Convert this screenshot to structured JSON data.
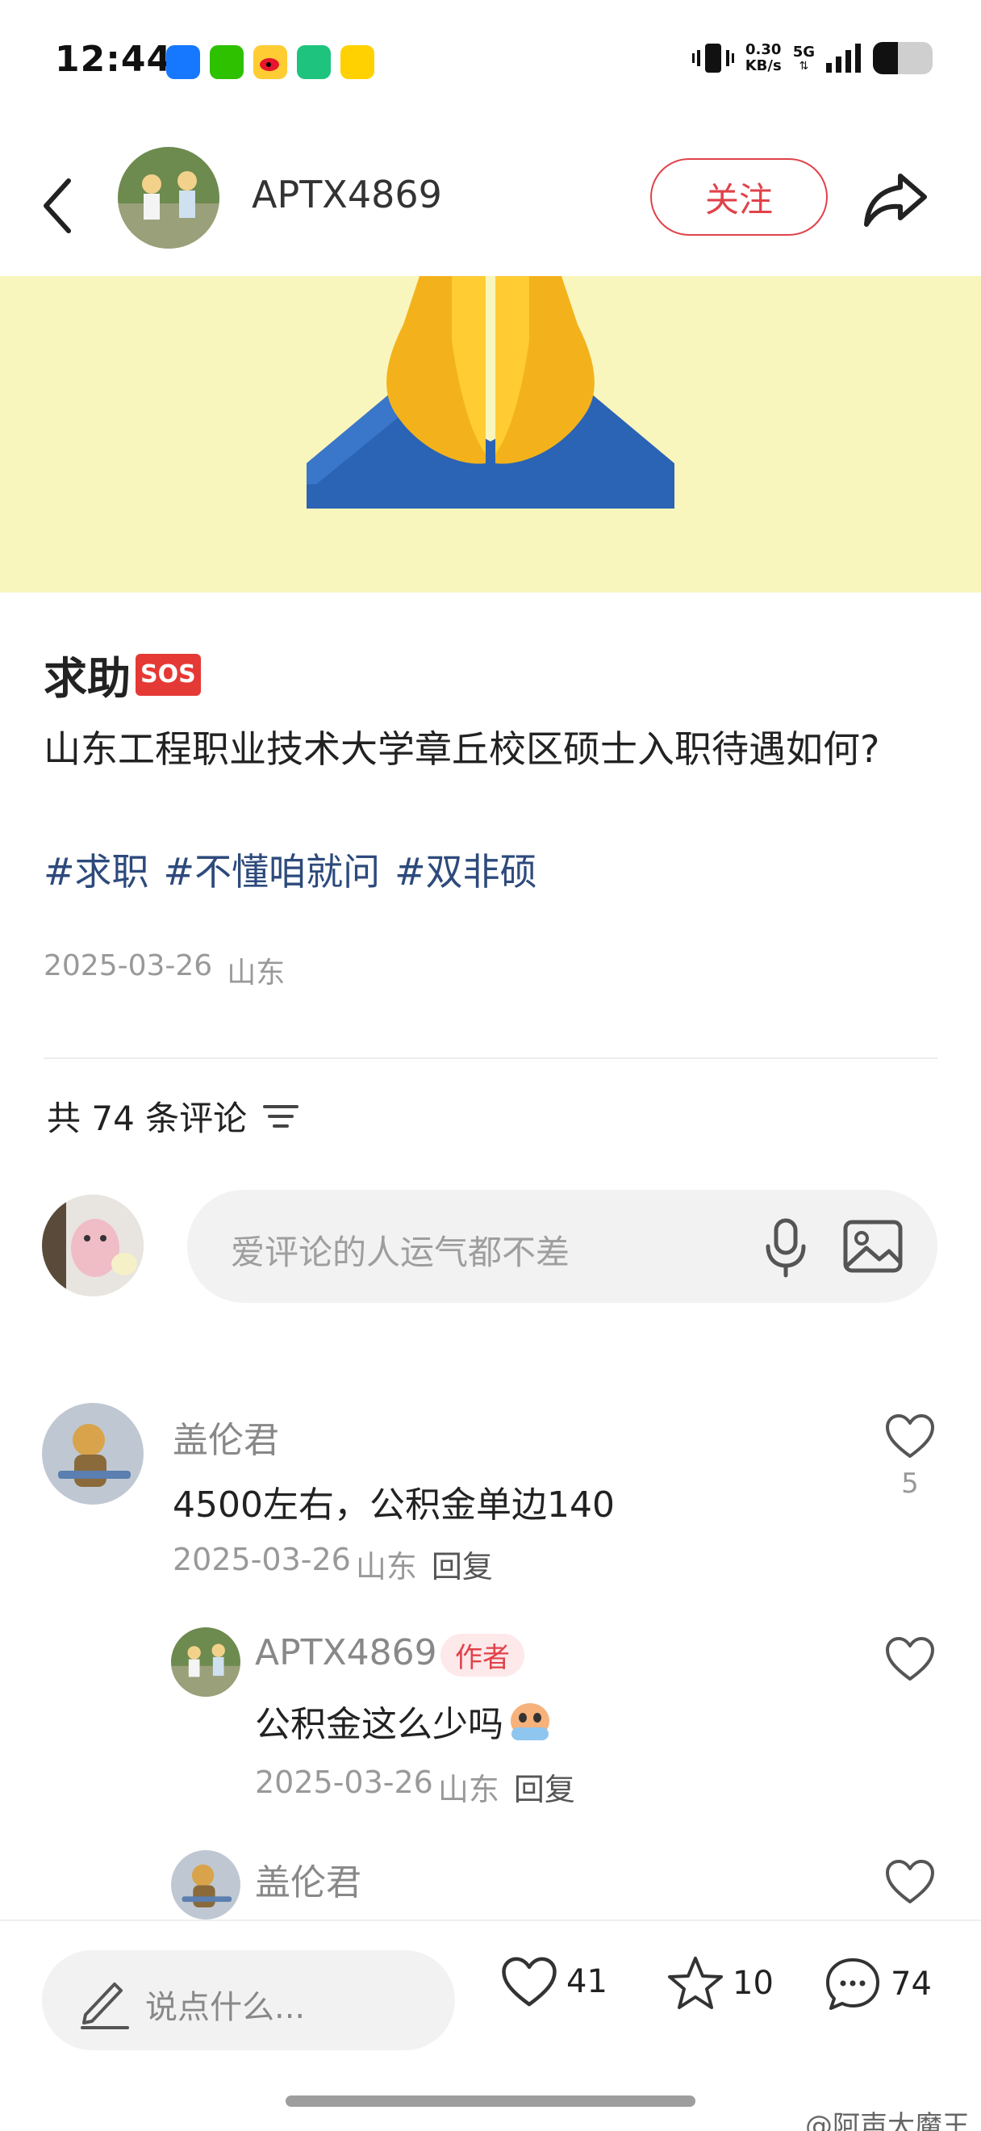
{
  "status_bar": {
    "time": "12:44",
    "net_speed_value": "0.30",
    "net_speed_unit": "KB/s",
    "network": "5G"
  },
  "header": {
    "author_name": "APTX4869",
    "follow_label": "关注"
  },
  "post": {
    "title": "求助",
    "sos_badge": "SOS",
    "body": "山东工程职业技术大学章丘校区硕士入职待遇如何?",
    "tags": [
      "#求职",
      "#不懂咱就问",
      "#双非硕"
    ],
    "date": "2025-03-26",
    "location": "山东"
  },
  "comments_section": {
    "count_label": "共 74 条评论",
    "input_placeholder": "爱评论的人运气都不差"
  },
  "comments": [
    {
      "user": "盖伦君",
      "text": "4500左右，公积金单边140",
      "date": "2025-03-26",
      "location": "山东",
      "reply_label": "回复",
      "likes": "5"
    }
  ],
  "replies": [
    {
      "user": "APTX4869",
      "badge": "作者",
      "text": "公积金这么少吗",
      "date": "2025-03-26",
      "location": "山东",
      "reply_label": "回复"
    },
    {
      "user": "盖伦君"
    }
  ],
  "bottom_bar": {
    "say_placeholder": "说点什么...",
    "likes": "41",
    "favorites": "10",
    "comments": "74"
  },
  "watermark": "@阿声大魔王",
  "colors": {
    "accent_red": "#e0424a",
    "tag_blue": "#2d4a7c",
    "hero_bg": "#f9f6bd"
  }
}
